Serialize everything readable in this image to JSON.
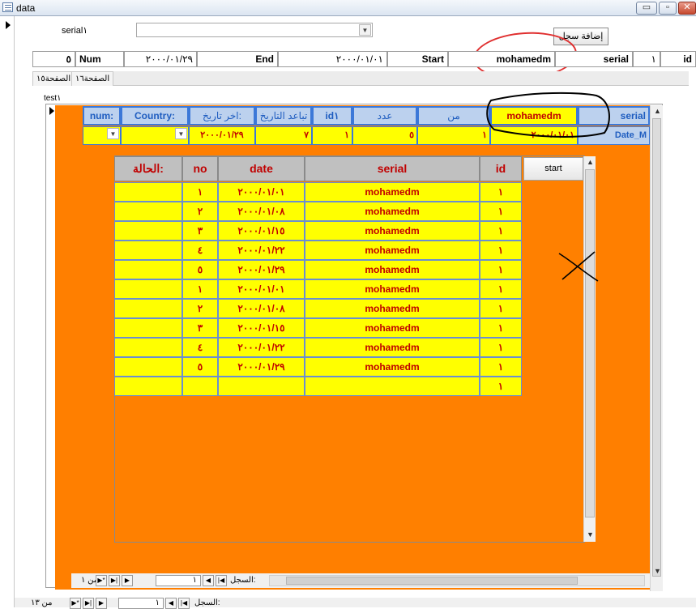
{
  "window": {
    "title": "data",
    "min": "▭",
    "max": "▫",
    "close": "✕"
  },
  "form": {
    "serial1_label": "serial١",
    "add_record": "إضافة سجل",
    "header_row": {
      "id_label": "id",
      "id_value": "١",
      "serial_label": "serial",
      "serial_value": "mohamedm",
      "start_label": "Start",
      "start_value": "٢٠٠٠/٠١/٠١",
      "end_label": "End",
      "end_value": "٢٠٠٠/٠١/٢٩",
      "num_label": "Num",
      "num_value": "٥"
    },
    "tabs": [
      "الصفحة١٥",
      "الصفحة١٦"
    ]
  },
  "subform": {
    "label": "test١",
    "headers": {
      "serial": "serial",
      "mohamedm": "mohamedm",
      "from": "من",
      "count": "عدد",
      "id1": "id١",
      "date_diff": "تباعد التاريخ",
      "last_date": "اخر تاريخ:",
      "country": "Country:",
      "num": "num:"
    },
    "row": {
      "serial": "Date_M",
      "mohamedm": "٢٠٠٠/٠١/٠١",
      "from": "١",
      "count": "٥",
      "id1": "١",
      "date_diff": "٧",
      "last_date": "٢٠٠٠/٠١/٢٩",
      "country": "",
      "num": ""
    },
    "nav": {
      "record_label": "السجل:",
      "current": "١",
      "of": "من ١"
    }
  },
  "inner": {
    "start_button": "start",
    "columns": [
      "id",
      "serial",
      "date",
      "no",
      "الحالة:"
    ],
    "rows": [
      [
        "١",
        "mohamedm",
        "٢٠٠٠/٠١/٠١",
        "١",
        ""
      ],
      [
        "١",
        "mohamedm",
        "٢٠٠٠/٠١/٠٨",
        "٢",
        ""
      ],
      [
        "١",
        "mohamedm",
        "٢٠٠٠/٠١/١٥",
        "٣",
        ""
      ],
      [
        "١",
        "mohamedm",
        "٢٠٠٠/٠١/٢٢",
        "٤",
        ""
      ],
      [
        "١",
        "mohamedm",
        "٢٠٠٠/٠١/٢٩",
        "٥",
        ""
      ],
      [
        "١",
        "mohamedm",
        "٢٠٠٠/٠١/٠١",
        "١",
        ""
      ],
      [
        "١",
        "mohamedm",
        "٢٠٠٠/٠١/٠٨",
        "٢",
        ""
      ],
      [
        "١",
        "mohamedm",
        "٢٠٠٠/٠١/١٥",
        "٣",
        ""
      ],
      [
        "١",
        "mohamedm",
        "٢٠٠٠/٠١/٢٢",
        "٤",
        ""
      ],
      [
        "١",
        "mohamedm",
        "٢٠٠٠/٠١/٢٩",
        "٥",
        ""
      ],
      [
        "١",
        "",
        "",
        "",
        ""
      ]
    ]
  },
  "main_nav": {
    "record_label": "السجل:",
    "current": "١",
    "of": "من ١٣"
  },
  "colors": {
    "orange": "#ff7f00",
    "yellow": "#ffff00",
    "header_blue": "#bcd1ee",
    "red_text": "#c00000",
    "annotation_red": "#e03030"
  }
}
